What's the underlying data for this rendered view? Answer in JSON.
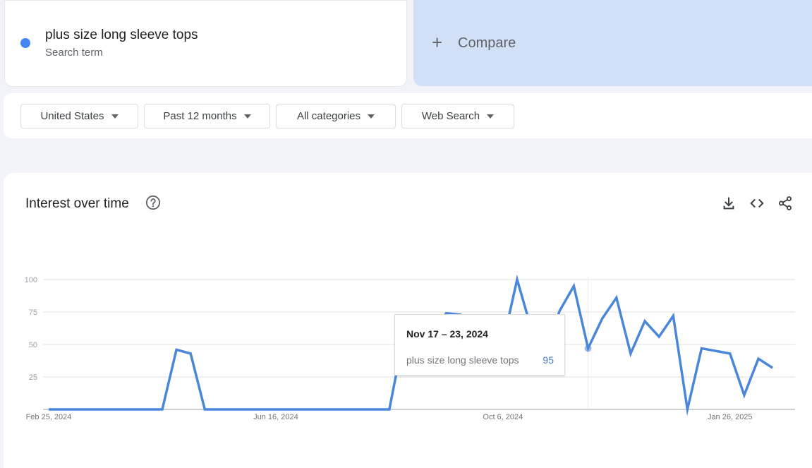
{
  "search_term": {
    "name": "plus size long sleeve tops",
    "subtitle": "Search term",
    "color": "#4285f4"
  },
  "compare": {
    "plus": "+",
    "label": "Compare"
  },
  "filters": [
    {
      "label": "United States"
    },
    {
      "label": "Past 12 months"
    },
    {
      "label": "All categories"
    },
    {
      "label": "Web Search"
    }
  ],
  "chart": {
    "title": "Interest over time",
    "icons": [
      "help-icon",
      "download-icon",
      "embed-icon",
      "share-icon"
    ]
  },
  "tooltip": {
    "date": "Nov 17 – 23, 2024",
    "term": "plus size long sleeve tops",
    "value": "95"
  },
  "chart_data": {
    "type": "line",
    "y_ticks": [
      25,
      50,
      75,
      100
    ],
    "ylim": [
      0,
      100
    ],
    "x_tick_labels": [
      {
        "label": "Feb 25, 2024",
        "index": 0
      },
      {
        "label": "Jun 16, 2024",
        "index": 16
      },
      {
        "label": "Oct 6, 2024",
        "index": 32
      },
      {
        "label": "Jan 26, 2025",
        "index": 48
      }
    ],
    "highlight_index": 38,
    "grid": true,
    "series": [
      {
        "color": "#4a86d9",
        "values": [
          0,
          0,
          0,
          0,
          0,
          0,
          0,
          0,
          0,
          46,
          43,
          0,
          0,
          0,
          0,
          0,
          0,
          0,
          0,
          0,
          0,
          0,
          0,
          0,
          0,
          56,
          53,
          58,
          74,
          73,
          41,
          58,
          51,
          100,
          62,
          45,
          76,
          95,
          47,
          70,
          86,
          43,
          68,
          56,
          72,
          0,
          47,
          45,
          43,
          11,
          39,
          32
        ]
      }
    ]
  }
}
